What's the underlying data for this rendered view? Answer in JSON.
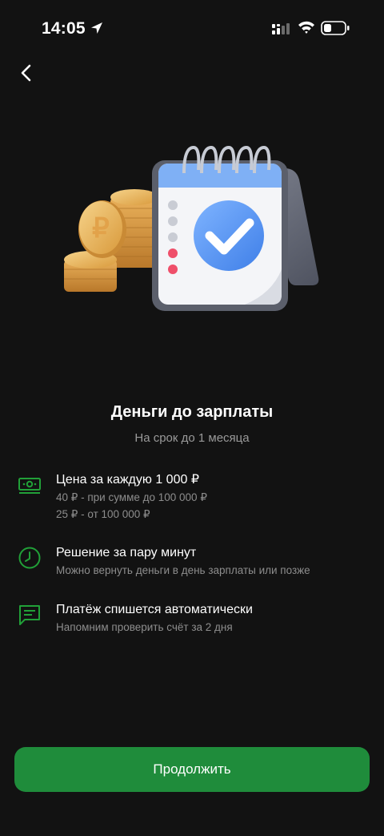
{
  "status_bar": {
    "time": "14:05"
  },
  "icons": {
    "back": "chevron-left-icon",
    "location": "location-arrow-icon",
    "signal": "cellular-signal-icon",
    "wifi": "wifi-icon",
    "battery": "battery-icon"
  },
  "colors": {
    "accent": "#1f8c3b",
    "icon_green": "#21a038",
    "background": "#121212",
    "text_secondary": "#8d8d8d"
  },
  "header": {
    "title": "Деньги до зарплаты",
    "subtitle": "На срок до 1 месяца"
  },
  "features": [
    {
      "icon": "banknote-icon",
      "title": "Цена за каждую 1 000 ₽",
      "lines": [
        "40 ₽ - при сумме до 100 000 ₽",
        "25 ₽ - от 100 000 ₽"
      ]
    },
    {
      "icon": "clock-icon",
      "title": "Решение за пару минут",
      "lines": [
        "Можно вернуть деньги в день зарплаты или позже"
      ]
    },
    {
      "icon": "message-icon",
      "title": "Платёж спишется автоматически",
      "lines": [
        "Напомним проверить счёт за 2 дня"
      ]
    }
  ],
  "continue_button": {
    "label": "Продолжить"
  }
}
